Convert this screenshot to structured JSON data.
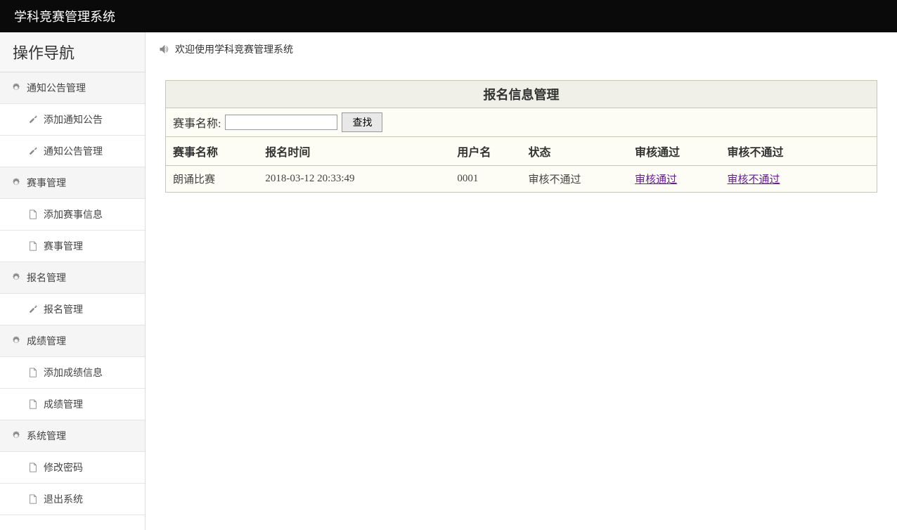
{
  "header": {
    "title": "学科竞赛管理系统"
  },
  "sidebar": {
    "title": "操作导航",
    "groups": [
      {
        "label": "通知公告管理",
        "icon": "gear",
        "items": [
          {
            "label": "添加通知公告",
            "icon": "wrench"
          },
          {
            "label": "通知公告管理",
            "icon": "wrench"
          }
        ]
      },
      {
        "label": "赛事管理",
        "icon": "gear",
        "items": [
          {
            "label": "添加赛事信息",
            "icon": "file"
          },
          {
            "label": "赛事管理",
            "icon": "file"
          }
        ]
      },
      {
        "label": "报名管理",
        "icon": "gear",
        "items": [
          {
            "label": "报名管理",
            "icon": "wrench"
          }
        ]
      },
      {
        "label": "成绩管理",
        "icon": "gear",
        "items": [
          {
            "label": "添加成绩信息",
            "icon": "file"
          },
          {
            "label": "成绩管理",
            "icon": "file"
          }
        ]
      },
      {
        "label": "系统管理",
        "icon": "gear",
        "items": [
          {
            "label": "修改密码",
            "icon": "file"
          },
          {
            "label": "退出系统",
            "icon": "file"
          }
        ]
      }
    ]
  },
  "welcome": {
    "text": "欢迎使用学科竞赛管理系统"
  },
  "panel": {
    "title": "报名信息管理",
    "search": {
      "label": "赛事名称:",
      "button": "查找",
      "value": ""
    },
    "columns": [
      "赛事名称",
      "报名时间",
      "用户名",
      "状态",
      "审核通过",
      "审核不通过"
    ],
    "rows": [
      {
        "event_name": "朗诵比赛",
        "signup_time": "2018-03-12 20:33:49",
        "username": "0001",
        "status": "审核不通过",
        "approve_link": "审核通过",
        "reject_link": "审核不通过"
      }
    ]
  }
}
